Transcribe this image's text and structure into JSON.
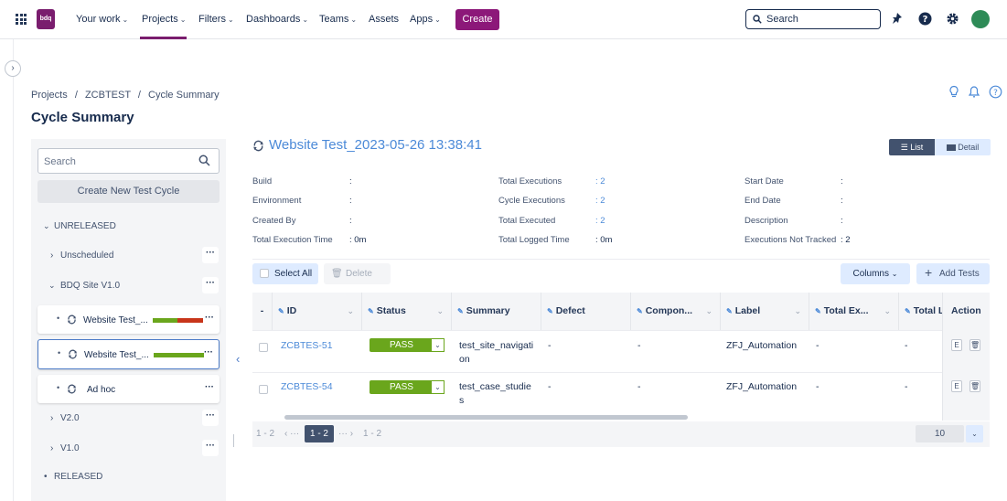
{
  "nav": {
    "logo": "bdq",
    "items": [
      "Your work",
      "Projects",
      "Filters",
      "Dashboards",
      "Teams",
      "Assets",
      "Apps"
    ],
    "create_label": "Create",
    "search_placeholder": "Search"
  },
  "breadcrumb": {
    "parts": [
      "Projects",
      "ZCBTEST",
      "Cycle Summary"
    ],
    "separator": "/"
  },
  "page_title": "Cycle Summary",
  "sidebar": {
    "search_placeholder": "Search",
    "new_cycle_label": "Create New Test Cycle",
    "unreleased_label": "UNRELEASED",
    "unscheduled_label": "Unscheduled",
    "bdq_site_label": "BDQ Site V1.0",
    "cycles": [
      {
        "label": "Website Test_...",
        "bar": [
          {
            "color": "#6aa61c",
            "fraction": 0.5
          },
          {
            "color": "#c8351a",
            "fraction": 0.5
          }
        ]
      },
      {
        "label": "Website Test_...",
        "bar": [
          {
            "color": "#6aa61c",
            "fraction": 1.0
          }
        ]
      },
      {
        "label": "Ad hoc"
      }
    ],
    "v2_label": "V2.0",
    "v1_label": "V1.0",
    "released_label": "RELEASED",
    "dots_label": "···"
  },
  "main": {
    "cycle_title": "Website Test_2023-05-26 13:38:41",
    "view_list_label": "List",
    "view_detail_label": "Detail",
    "info": {
      "build_label": "Build",
      "build_val": ":",
      "environment_label": "Environment",
      "environment_val": ":",
      "created_by_label": "Created By",
      "created_by_val": ":",
      "total_exec_time_label": "Total Execution Time",
      "total_exec_time_val": ":  0m",
      "total_executions_label": "Total Executions",
      "total_executions_val": ":  2",
      "cycle_executions_label": "Cycle Executions",
      "cycle_executions_val": ":  2",
      "total_executed_label": "Total Executed",
      "total_executed_val": ":  2",
      "total_logged_time_label": "Total Logged Time",
      "total_logged_time_val": ":  0m",
      "start_date_label": "Start Date",
      "start_date_val": ":",
      "end_date_label": "End Date",
      "end_date_val": ":",
      "description_label": "Description",
      "description_val": ":",
      "not_tracked_label": "Executions Not Tracked",
      "not_tracked_val": ":  2"
    },
    "toolbar": {
      "select_all_label": "Select All",
      "delete_label": "Delete",
      "columns_label": "Columns",
      "add_tests_label": "Add Tests"
    },
    "table": {
      "headers": {
        "dash": "-",
        "id": "ID",
        "status": "Status",
        "summary": "Summary",
        "defect": "Defect",
        "component": "Compon...",
        "label": "Label",
        "total_ex": "Total Ex...",
        "total_l": "Total L",
        "action": "Action"
      },
      "rows": [
        {
          "id": "ZCBTES-51",
          "status": "PASS",
          "summary_l1": "test_site_navigati",
          "summary_l2": "on",
          "defect": "-",
          "component": "-",
          "label": "ZFJ_Automation",
          "total_ex": "-",
          "total_l": "-"
        },
        {
          "id": "ZCBTES-54",
          "status": "PASS",
          "summary_l1": "test_case_studie",
          "summary_l2": "s",
          "defect": "-",
          "component": "-",
          "label": "ZFJ_Automation",
          "total_ex": "-",
          "total_l": "-"
        }
      ],
      "action_e": "E",
      "action_del": "🗑"
    },
    "pager": {
      "range_left": "1 - 2",
      "prev": "‹ ···",
      "current": "1 - 2",
      "next": "··· ›",
      "range_right": "1 - 2",
      "page_size": "10"
    }
  }
}
